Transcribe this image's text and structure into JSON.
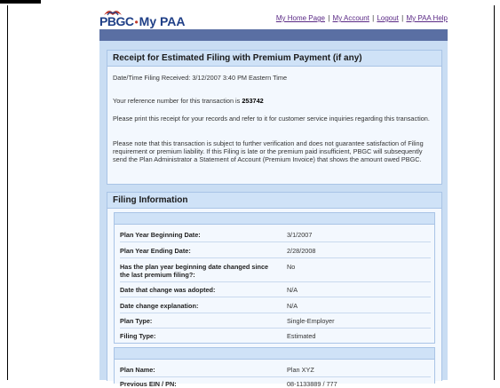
{
  "header": {
    "logo_pbgc": "PBGC",
    "logo_product": "My PAA",
    "nav": [
      {
        "label": "My Home Page"
      },
      {
        "label": "My Account"
      },
      {
        "label": "Logout"
      },
      {
        "label": "My PAA Help"
      }
    ],
    "nav_separator": "|"
  },
  "receipt": {
    "title": "Receipt for Estimated Filing with Premium Payment (if any)",
    "received": "Date/Time Filing Received: 3/12/2007 3:40 PM Eastern Time",
    "ref_prefix": "Your reference number for this transaction is ",
    "ref_number": "253742",
    "print_note": "Please print this receipt for your records and refer to it for customer service inquiries regarding this transaction.",
    "verify_note": "Please note that this transaction is subject to further verification and does not guarantee satisfaction of Filing requirement or premium liability. If this Filing is late or the premium paid insufficient, PBGC will subsequently send the Plan Administrator a Statement of Account (Premium Invoice) that shows the amount owed PBGC."
  },
  "filing": {
    "title": "Filing Information",
    "rows": [
      {
        "label": "Plan Year Beginning Date:",
        "value": "3/1/2007"
      },
      {
        "label": "Plan Year Ending Date:",
        "value": "2/28/2008"
      },
      {
        "label": "Has the plan year beginning date changed since the last premium filing?:",
        "value": "No"
      },
      {
        "label": "Date that change was adopted:",
        "value": "N/A"
      },
      {
        "label": "Date change explanation:",
        "value": "N/A"
      },
      {
        "label": "Plan Type:",
        "value": "Single-Employer"
      },
      {
        "label": "Filing Type:",
        "value": "Estimated"
      }
    ],
    "plan_rows": [
      {
        "label": "Plan Name:",
        "value": "Plan XYZ"
      },
      {
        "label": "Previous EIN / PN:",
        "value": "08-1133889 / 777"
      }
    ]
  },
  "colors": {
    "brand_blue": "#1f3f87",
    "banner": "#5a6fa3",
    "panel_bg": "#c9ddf3",
    "link": "#5b2a86"
  }
}
